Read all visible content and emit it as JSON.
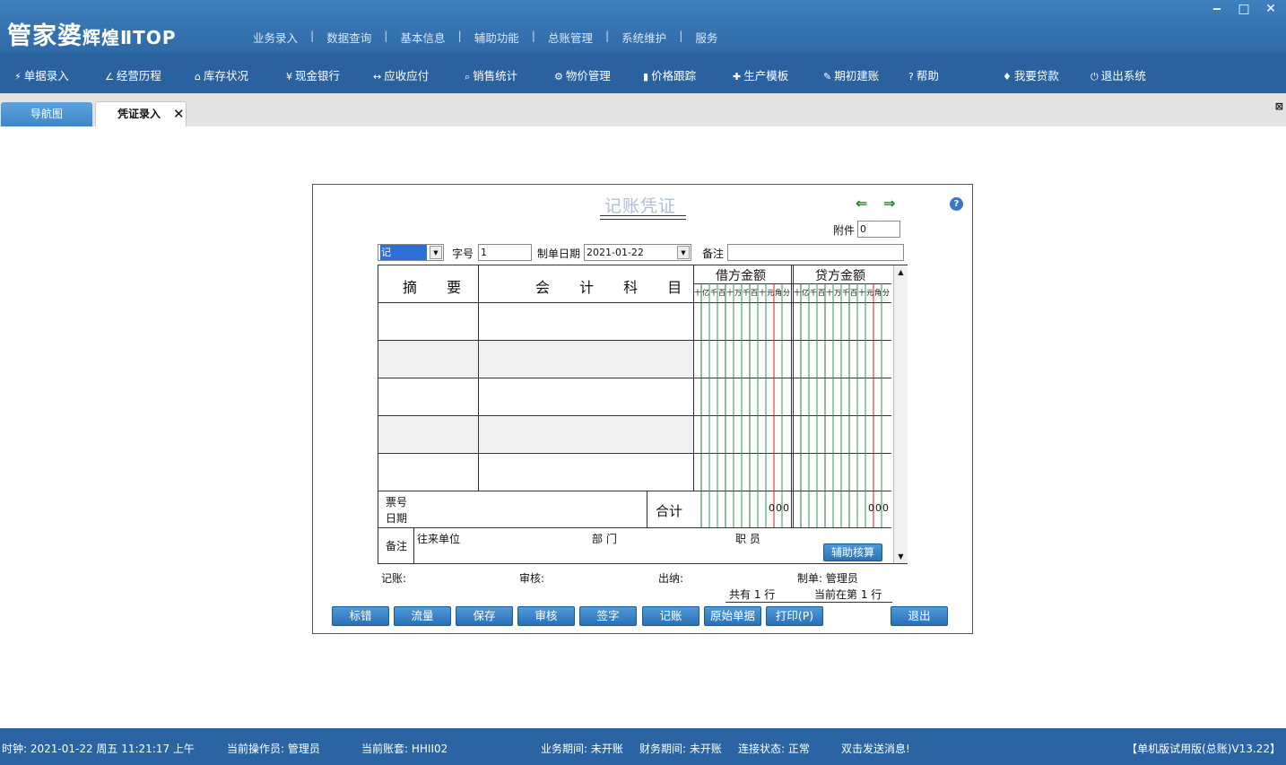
{
  "app": {
    "logo": "管家婆",
    "logo_sub": "辉煌ⅡTOP"
  },
  "top_menu": [
    "业务录入",
    "数据查询",
    "基本信息",
    "辅助功能",
    "总账管理",
    "系统维护",
    "服务"
  ],
  "window_controls": {
    "minimize": "‒",
    "maximize": "□",
    "close": "✕"
  },
  "toolbar": {
    "items": [
      {
        "icon": "voucher-icon",
        "glyph": "⚡",
        "label": "单据录入"
      },
      {
        "icon": "trend-icon",
        "glyph": "📈",
        "label": "经营历程"
      },
      {
        "icon": "home-icon",
        "glyph": "⌂",
        "label": "库存状况"
      },
      {
        "icon": "yen-icon",
        "glyph": "¥",
        "label": "现金银行"
      },
      {
        "icon": "exchange-icon",
        "glyph": "↔",
        "label": "应收应付"
      },
      {
        "icon": "search-icon",
        "glyph": "🔍",
        "label": "销售统计"
      },
      {
        "icon": "gear-icon",
        "glyph": "⚙",
        "label": "物价管理"
      },
      {
        "icon": "bar-chart-icon",
        "glyph": "▮",
        "label": "价格跟踪"
      },
      {
        "icon": "wrench-icon",
        "glyph": "🔧",
        "label": "生产模板"
      },
      {
        "icon": "edit-icon",
        "glyph": "✎",
        "label": "期初建账"
      },
      {
        "icon": "help-icon",
        "glyph": "?",
        "label": "帮助"
      },
      {
        "icon": "money-bag-icon",
        "glyph": "💰",
        "label": "我要贷款"
      },
      {
        "icon": "power-icon",
        "glyph": "⏻",
        "label": "退出系统"
      }
    ]
  },
  "tabs": {
    "nav": "导航图",
    "voucher": "凭证录入",
    "close": "✕"
  },
  "voucher": {
    "title": "记账凭证",
    "attachment_label": "附件",
    "attachment_value": "0",
    "type_value": "记",
    "zihao_label": "字号",
    "zihao_value": "1",
    "date_label": "制单日期",
    "date_value": "2021-01-22",
    "remark_label": "备注",
    "remark_value": "",
    "col_summary": "摘 要",
    "col_account": "会 计 科 目",
    "col_debit": "借方金额",
    "col_credit": "贷方金额",
    "digit_labels": [
      "十",
      "亿",
      "千",
      "百",
      "十",
      "万",
      "千",
      "百",
      "十",
      "元",
      "角",
      "分"
    ],
    "ticket_no_label": "票号",
    "ticket_date_label": "日期",
    "total_label": "合计",
    "debit_total": "000",
    "credit_total": "000",
    "remark_row_label": "备注",
    "partner_label": "往来单位",
    "dept_label": "部 门",
    "staff_label": "职 员",
    "aux_button": "辅助核算",
    "posted_label": "记账:",
    "audit_label": "审核:",
    "cashier_label": "出纳:",
    "maker_label": "制单: 管理员",
    "total_rows": "共有  1  行",
    "current_row": "当前在第  1  行"
  },
  "buttons": [
    "标错",
    "流量",
    "保存",
    "审核",
    "签字",
    "记账",
    "原始单据",
    "打印(P)",
    "退出"
  ],
  "status": {
    "clock": "时钟: 2021-01-22 周五 11:21:17 上午",
    "operator": "当前操作员: 管理员",
    "account_set": "当前账套: HHII02",
    "biz_period": "业务期间: 未开账",
    "fin_period": "财务期间: 未开账",
    "conn": "连接状态: 正常",
    "message": "双击发送消息!",
    "version": "【单机版试用版(总账)V13.22】"
  }
}
